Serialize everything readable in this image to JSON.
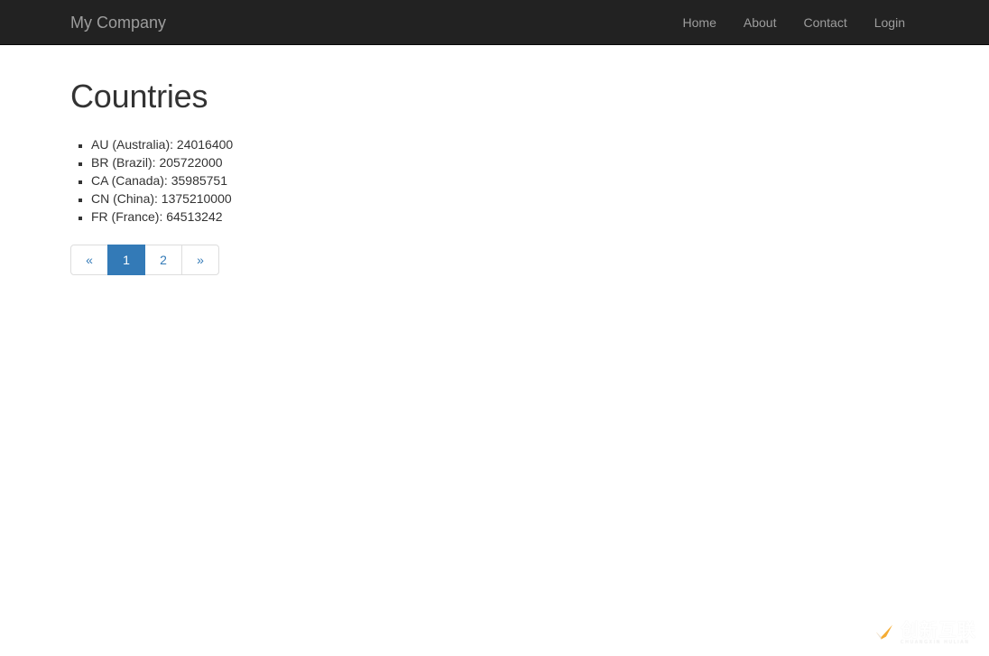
{
  "navbar": {
    "brand": "My Company",
    "links": [
      {
        "label": "Home"
      },
      {
        "label": "About"
      },
      {
        "label": "Contact"
      },
      {
        "label": "Login"
      }
    ],
    "background_color": "#222222",
    "link_color": "#9d9d9d"
  },
  "main": {
    "title": "Countries",
    "countries": [
      {
        "text": "AU (Australia): 24016400",
        "code": "AU",
        "name": "Australia",
        "population": "24016400"
      },
      {
        "text": "BR (Brazil): 205722000",
        "code": "BR",
        "name": "Brazil",
        "population": "205722000"
      },
      {
        "text": "CA (Canada): 35985751",
        "code": "CA",
        "name": "Canada",
        "population": "35985751"
      },
      {
        "text": "CN (China): 1375210000",
        "code": "CN",
        "name": "China",
        "population": "1375210000"
      },
      {
        "text": "FR (France): 64513242",
        "code": "FR",
        "name": "France",
        "population": "64513242"
      }
    ]
  },
  "pagination": {
    "prev_label": "«",
    "next_label": "»",
    "pages": [
      {
        "label": "1",
        "active": true
      },
      {
        "label": "2",
        "active": false
      }
    ],
    "active_color": "#337ab7",
    "link_color": "#337ab7",
    "border_color": "#dddddd"
  },
  "watermark": {
    "icon": "check-circle-logo-icon",
    "text": "创新互联",
    "subtext": "CHUANGXIN HULIAN",
    "accent_color": "#f5a623"
  }
}
